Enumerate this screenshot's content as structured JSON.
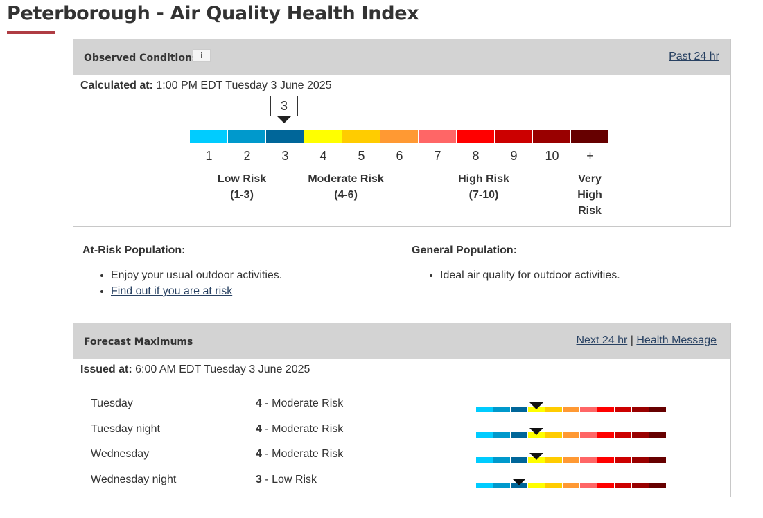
{
  "page": {
    "title": "Peterborough - Air Quality Health Index"
  },
  "observed": {
    "heading": "Observed Conditions",
    "tooltip_label": "i",
    "past_link": "Past 24 hr",
    "calc_label": "Calculated at:",
    "calc_value": "1:00 PM EDT Tuesday 3 June 2025",
    "current_value": "3",
    "scale_labels": [
      "1",
      "2",
      "3",
      "4",
      "5",
      "6",
      "7",
      "8",
      "9",
      "10",
      "+"
    ],
    "scale_colors": [
      "#00ccff",
      "#0099cc",
      "#006699",
      "#ffff00",
      "#ffcc00",
      "#ff9933",
      "#ff6666",
      "#ff0000",
      "#cc0000",
      "#990000",
      "#660000"
    ],
    "risks": [
      {
        "name": "Low Risk",
        "range": "(1-3)"
      },
      {
        "name": "Moderate Risk",
        "range": "(4-6)"
      },
      {
        "name": "High Risk",
        "range": "(7-10)"
      },
      {
        "name": "Very High Risk"
      }
    ]
  },
  "at_risk": {
    "heading": "At-Risk Population:",
    "items": [
      "Enjoy your usual outdoor activities."
    ],
    "link": "Find out if you are at risk"
  },
  "general": {
    "heading": "General Population:",
    "items": [
      "Ideal air quality for outdoor activities."
    ]
  },
  "forecast": {
    "heading": "Forecast Maximums",
    "next_link": "Next 24 hr",
    "separator": "|",
    "health_link": "Health Message",
    "issued_label": "Issued at:",
    "issued_value": "6:00 AM EDT Tuesday 3 June 2025",
    "rows": [
      {
        "period": "Tuesday",
        "value": "4",
        "risk": " - Moderate Risk",
        "level": 4
      },
      {
        "period": "Tuesday night",
        "value": "4",
        "risk": " - Moderate Risk",
        "level": 4
      },
      {
        "period": "Wednesday",
        "value": "4",
        "risk": " - Moderate Risk",
        "level": 4
      },
      {
        "period": "Wednesday night",
        "value": "3",
        "risk": " - Low Risk",
        "level": 3
      }
    ]
  }
}
